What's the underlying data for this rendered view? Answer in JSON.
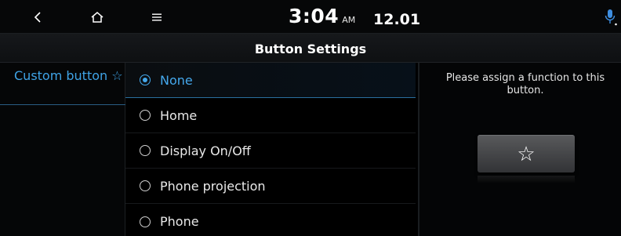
{
  "statusbar": {
    "back_icon": "back-arrow-icon",
    "home_icon": "home-icon",
    "menu_icon": "menu-icon",
    "time": "3:04",
    "ampm": "AM",
    "date": "12.01",
    "mic_icon": "voice-mic-icon",
    "accent": "#45a8ec"
  },
  "header": {
    "title": "Button Settings"
  },
  "sidebar": {
    "items": [
      {
        "label": "Custom button ☆"
      }
    ]
  },
  "options": [
    {
      "label": "None",
      "selected": true
    },
    {
      "label": "Home",
      "selected": false
    },
    {
      "label": "Display On/Off",
      "selected": false
    },
    {
      "label": "Phone projection",
      "selected": false
    },
    {
      "label": "Phone",
      "selected": false
    }
  ],
  "detail": {
    "description": "Please assign a function to this button.",
    "button_icon": "star-icon",
    "button_glyph": "☆"
  }
}
